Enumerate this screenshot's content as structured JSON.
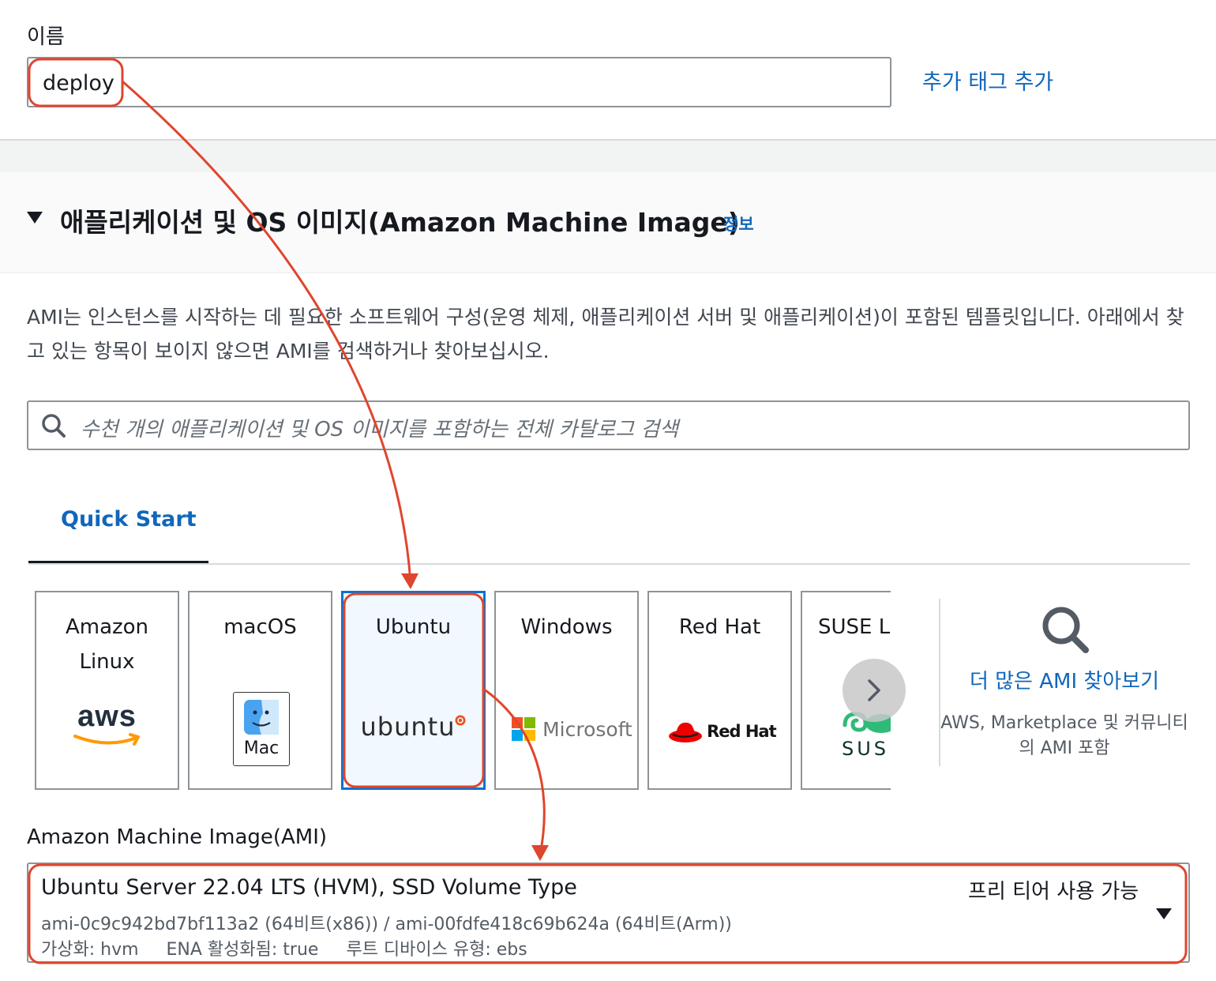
{
  "name_field": {
    "label": "이름",
    "value": "deploy",
    "add_tag_link": "추가 태그 추가"
  },
  "ami_section": {
    "title": "애플리케이션 및 OS 이미지(Amazon Machine Image)",
    "info_link": "정보",
    "description": "AMI는 인스턴스를 시작하는 데 필요한 소프트웨어 구성(운영 체제, 애플리케이션 서버 및 애플리케이션)이 포함된 템플릿입니다. 아래에서 찾고 있는 항목이 보이지 않으면 AMI를 검색하거나 찾아보십시오.",
    "search_placeholder": "수천 개의 애플리케이션 및 OS 이미지를 포함하는 전체 카탈로그 검색"
  },
  "tabs": [
    {
      "label": "Quick Start",
      "active": true
    }
  ],
  "os_cards": [
    {
      "title": "Amazon Linux",
      "logo": "aws-logo",
      "logo_text": "aws"
    },
    {
      "title": "macOS",
      "logo": "mac-finder-icon",
      "logo_text": "Mac"
    },
    {
      "title": "Ubuntu",
      "logo": "ubuntu-logo",
      "logo_text": "ubuntu",
      "selected": true
    },
    {
      "title": "Windows",
      "logo": "microsoft-logo",
      "logo_text": "Microsoft"
    },
    {
      "title": "Red Hat",
      "logo": "redhat-logo",
      "logo_text": "Red Hat"
    },
    {
      "title": "SUSE Li",
      "logo": "suse-logo",
      "logo_text": "SUS"
    }
  ],
  "browse_more": {
    "link": "더 많은 AMI 찾아보기",
    "subtitle": "AWS, Marketplace 및 커뮤니티의 AMI 포함"
  },
  "ami_select": {
    "label": "Amazon Machine Image(AMI)",
    "name": "Ubuntu Server 22.04 LTS (HVM), SSD Volume Type",
    "badge": "프리 티어 사용 가능",
    "ids": "ami-0c9c942bd7bf113a2 (64비트(x86)) / ami-00fdfe418c69b624a (64비트(Arm))",
    "virtualization": "가상화: hvm",
    "ena": "ENA 활성화됨: true",
    "root_device": "루트 디바이스 유형: ebs"
  },
  "colors": {
    "link": "#1166bb",
    "selection_blue": "#0972d3",
    "annotation_red": "#e0452e"
  }
}
